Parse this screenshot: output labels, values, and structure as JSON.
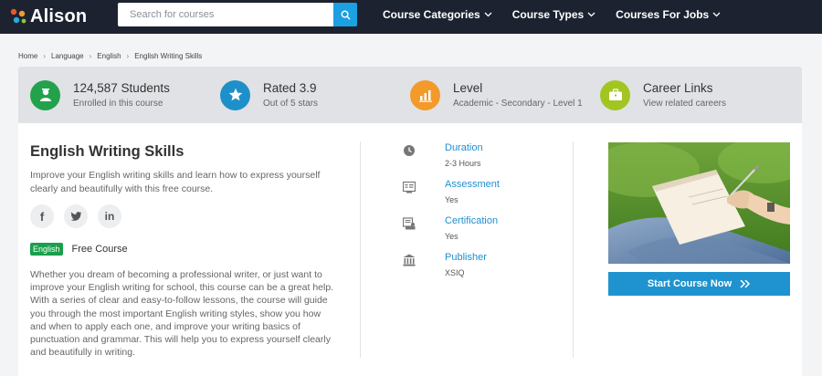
{
  "nav": {
    "logo_text": "Alison",
    "search_placeholder": "Search for courses",
    "links": [
      "Course Categories",
      "Course Types",
      "Courses For Jobs"
    ],
    "brand_color": "#1c2230",
    "accent_color": "#1ba0e1"
  },
  "breadcrumb": [
    "Home",
    "Language",
    "English",
    "English Writing Skills"
  ],
  "stats": [
    {
      "title": "124,587 Students",
      "sub": "Enrolled in this course",
      "icon": "graduate-icon",
      "color": "#22a24c"
    },
    {
      "title": "Rated 3.9",
      "sub": "Out of 5 stars",
      "icon": "star-icon",
      "color": "#1e90c9"
    },
    {
      "title": "Level",
      "sub": "Academic - Secondary - Level 1",
      "icon": "bar-chart-icon",
      "color": "#f39a2b"
    },
    {
      "title": "Career Links",
      "sub": "View related careers",
      "icon": "briefcase-icon",
      "color": "#a3c522"
    }
  ],
  "course": {
    "title": "English Writing Skills",
    "short_desc": "Improve your English writing skills and learn how to express yourself clearly and beautifully with this free course.",
    "social": [
      "f",
      "t",
      "in"
    ],
    "badge": "English",
    "price_label": "Free Course",
    "long_desc": "Whether you dream of becoming a professional writer, or just want to improve your English writing for school, this course can be a great help. With a series of clear and easy-to-follow lessons, the course will guide you through the most important English writing styles, show you how and when to apply each one, and improve your writing basics of punctuation and grammar. This will help you to express yourself clearly and beautifully in writing."
  },
  "meta": [
    {
      "label": "Duration",
      "value": "2-3 Hours",
      "icon": "clock-icon"
    },
    {
      "label": "Assessment",
      "value": "Yes",
      "icon": "assessment-icon"
    },
    {
      "label": "Certification",
      "value": "Yes",
      "icon": "certificate-icon"
    },
    {
      "label": "Publisher",
      "value": "XSIQ",
      "icon": "institution-icon"
    }
  ],
  "cta": {
    "label": "Start Course Now"
  }
}
